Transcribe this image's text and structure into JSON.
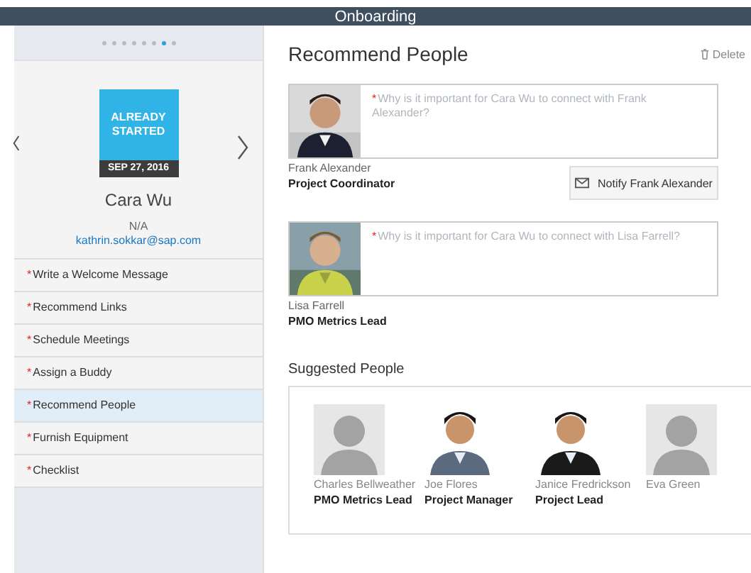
{
  "header": {
    "title": "Onboarding"
  },
  "pager": [
    {
      "selected": false
    },
    {
      "selected": false
    },
    {
      "selected": false
    },
    {
      "selected": false
    },
    {
      "selected": false
    },
    {
      "selected": false
    },
    {
      "selected": true
    },
    {
      "selected": false
    }
  ],
  "employee": {
    "status": "ALREADY STARTED",
    "date": "SEP 27, 2016",
    "name": "Cara Wu",
    "title": "N/A",
    "email": "kathrin.sokkar@sap.com"
  },
  "tasks": [
    {
      "mark": "*",
      "label": "Write a Welcome Message",
      "selected": false
    },
    {
      "mark": "*",
      "label": "Recommend Links",
      "selected": false
    },
    {
      "mark": "*",
      "label": "Schedule Meetings",
      "selected": false
    },
    {
      "mark": "*",
      "label": "Assign a Buddy",
      "selected": false
    },
    {
      "mark": "*",
      "label": "Recommend People",
      "selected": true
    },
    {
      "mark": "*",
      "label": "Furnish Equipment",
      "selected": false
    },
    {
      "mark": "*",
      "label": "Checklist",
      "selected": false
    }
  ],
  "section": {
    "title": "Recommend People",
    "delete": "Delete"
  },
  "recommended": [
    {
      "name": "Frank Alexander",
      "role": "Project Coordinator",
      "mark": "*",
      "placeholder": "Why is it important for Cara Wu to connect with Frank Alexander?",
      "notify": "Notify Frank Alexander"
    },
    {
      "name": "Lisa Farrell",
      "role": "PMO Metrics Lead",
      "mark": "*",
      "placeholder": "Why is it important for Cara Wu to connect with Lisa Farrell?"
    }
  ],
  "suggested": {
    "title": "Suggested People",
    "people": [
      {
        "name": "Charles Bellweather",
        "role": "PMO Metrics Lead",
        "kind": "placeholder"
      },
      {
        "name": "Joe Flores",
        "role": "Project Manager"
      },
      {
        "name": "Janice Fredrickson",
        "role": "Project Lead"
      },
      {
        "name": "Eva Green",
        "kind": "placeholder"
      }
    ]
  }
}
